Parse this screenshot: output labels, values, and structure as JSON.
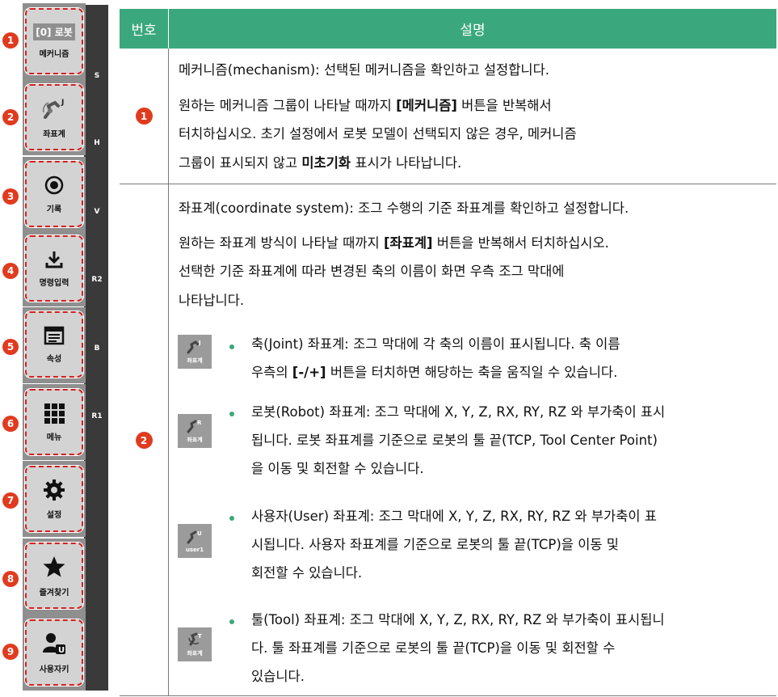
{
  "panel": {
    "axis_labels": [
      "S",
      "H",
      "V",
      "R2",
      "B",
      "R1"
    ],
    "buttons": [
      {
        "num": "1",
        "top_label": "[0] 로봇",
        "label": "메커니즘",
        "icon": "none"
      },
      {
        "num": "2",
        "label": "좌표계",
        "icon": "robot-joint-icon"
      },
      {
        "num": "3",
        "label": "기록",
        "icon": "record-icon"
      },
      {
        "num": "4",
        "label": "명령입력",
        "icon": "download-icon"
      },
      {
        "num": "5",
        "label": "속성",
        "icon": "properties-icon"
      },
      {
        "num": "6",
        "label": "메뉴",
        "icon": "grid-menu-icon"
      },
      {
        "num": "7",
        "label": "설정",
        "icon": "gear-icon"
      },
      {
        "num": "8",
        "label": "즐겨찾기",
        "icon": "star-icon"
      },
      {
        "num": "9",
        "label": "사용자키",
        "icon": "user-key-icon"
      }
    ]
  },
  "table": {
    "headers": {
      "num": "번호",
      "desc": "설명"
    },
    "row1": {
      "num": "1",
      "lines": [
        "메커니즘(mechanism): 선택된 메커니즘을 확인하고 설정합니다.",
        "원하는 메커니즘 그룹이 나타날 때까지 ",
        "[메커니즘]",
        " 버튼을 반복해서",
        "터치하십시오. 초기 설정에서 로봇 모델이 선택되지 않은 경우, 메커니즘",
        "그룹이 표시되지 않고 ",
        "미초기화",
        " 표시가 나타납니다."
      ]
    },
    "row2": {
      "num": "2",
      "line1": "좌표계(coordinate system): 조그 수행의 기준 좌표계를 확인하고 설정합니다.",
      "line2a": "원하는 좌표계 방식이 나타날 때까지 ",
      "line2b": "[좌표계]",
      "line2c": " 버튼을 반복해서 터치하십시오.",
      "line3": "선택한 기준 좌표계에 따라 변경된 축의 이름이 화면 우측 조그 막대에",
      "line4": "나타납니다.",
      "bullets": [
        {
          "icon_label": "좌표계",
          "icon": "joint-coord-icon",
          "lines": [
            "축(Joint) 좌표계: 조그 막대에 각 축의 이름이 표시됩니다. 축 이름"
          ],
          "l2a": "우측의 ",
          "l2b": "[-/+]",
          "l2c": " 버튼을 터치하면 해당하는 축을 움직일 수 있습니다."
        },
        {
          "icon_label": "좌표계",
          "icon": "robot-coord-icon",
          "lines": [
            "로봇(Robot) 좌표계: 조그 막대에 X, Y, Z, RX, RY, RZ 와 부가축이 표시",
            "됩니다. 로봇 좌표계를 기준으로 로봇의 툴 끝(TCP, Tool Center Point)",
            "을 이동 및 회전할 수 있습니다."
          ]
        },
        {
          "icon_label": "user1",
          "icon": "user-coord-icon",
          "lines": [
            "사용자(User) 좌표계: 조그 막대에 X, Y, Z, RX, RY, RZ 와 부가축이 표",
            "시됩니다. 사용자 좌표계를 기준으로 로봇의 툴 끝(TCP)을 이동 및",
            "회전할 수 있습니다."
          ]
        },
        {
          "icon_label": "좌표계",
          "icon": "tool-coord-icon",
          "lines": [
            "툴(Tool) 좌표계: 조그 막대에 X, Y, Z, RX, RY, RZ 와 부가축이 표시됩니",
            "다. 툴 좌표계를 기준으로 로봇의 툴 끝(TCP)을 이동 및 회전할 수",
            "있습니다."
          ]
        }
      ]
    }
  },
  "colors": {
    "header_green": "#3aa87c",
    "badge_red": "#e03b1f",
    "dash_red": "#d81e1e"
  }
}
